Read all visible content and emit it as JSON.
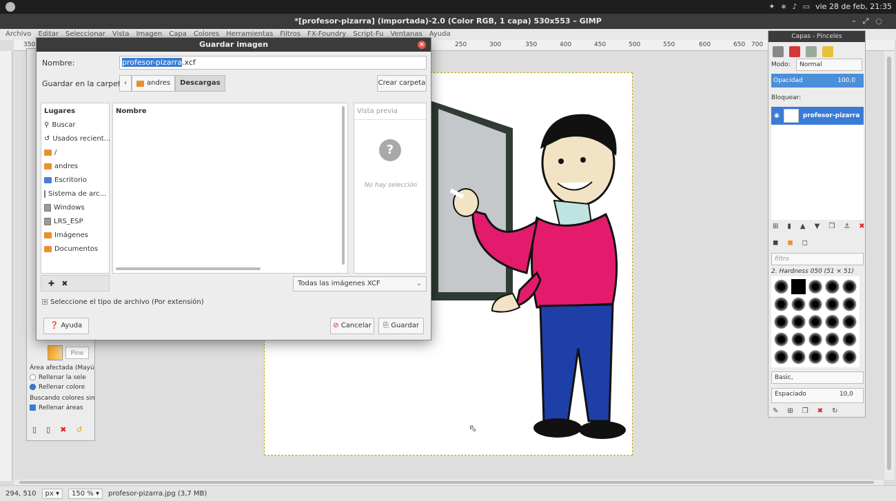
{
  "system": {
    "datetime": "vie 28 de feb, 21:35"
  },
  "gimp": {
    "window_title": "*[profesor-pizarra] (importada)-2.0 (Color RGB, 1 capa) 530x553 – GIMP",
    "menu": [
      "Archivo",
      "Editar",
      "Seleccionar",
      "Vista",
      "Imagen",
      "Capa",
      "Colores",
      "Herramientas",
      "Filtros",
      "FX-Foundry",
      "Script-Fu",
      "Ventanas",
      "Ayuda"
    ],
    "ruler_ticks": [
      "350",
      "250",
      "300",
      "350",
      "400",
      "450",
      "500",
      "550",
      "600",
      "650",
      "700"
    ]
  },
  "dialog": {
    "title": "Guardar imagen",
    "name_label": "Nombre:",
    "filename_selected": "profesor-pizarra",
    "filename_ext": ".xcf",
    "folder_label": "Guardar en la carpeta:",
    "breadcrumbs": [
      "andres",
      "Descargas"
    ],
    "create_folder": "Crear carpeta",
    "places_header": "Lugares",
    "places": [
      {
        "label": "Buscar",
        "icon": "search-icon"
      },
      {
        "label": "Usados recient...",
        "icon": "recent-icon"
      },
      {
        "label": "/",
        "icon": "folder-icon"
      },
      {
        "label": "andres",
        "icon": "folder-icon"
      },
      {
        "label": "Escritorio",
        "icon": "desktop-folder-icon"
      },
      {
        "label": "Sistema de arc...",
        "icon": "drive-icon"
      },
      {
        "label": "Windows",
        "icon": "drive-icon"
      },
      {
        "label": "LRS_ESP",
        "icon": "drive-icon"
      },
      {
        "label": "Imágenes",
        "icon": "folder-icon"
      },
      {
        "label": "Documentos",
        "icon": "folder-icon"
      }
    ],
    "files_header": "Nombre",
    "preview_header": "Vista previa",
    "preview_empty": "No hay selección",
    "filter_value": "Todas las imágenes XCF",
    "file_type_toggle": "Seleccione el tipo de archivo (Por extensión)",
    "help": "Ayuda",
    "cancel": "Cancelar",
    "save": "Guardar"
  },
  "toolbox": {
    "pine_label": "Pine",
    "affected_area": "Área afectada  (Mayú",
    "radio1": "Rellenar la sele",
    "radio2": "Rellenar colore",
    "search_label": "Buscando colores sin",
    "check1": "Rellenar áreas"
  },
  "layers_panel": {
    "title": "Capas - Pinceles",
    "mode_label": "Modo:",
    "mode_value": "Normal",
    "opacity_label": "Opacidad",
    "opacity_value": "100,0",
    "lock_label": "Bloquear:",
    "layer_name": "profesor-pizarra",
    "filter_placeholder": "filtro",
    "brush_name": "2. Hardness 050 (51 × 51)",
    "brush_preset": "Basic,",
    "spacing_label": "Espaciado",
    "spacing_value": "10,0"
  },
  "status": {
    "coords": "294, 510",
    "unit": "px",
    "zoom": "150 %",
    "file_info": "profesor-pizarra.jpg (3,7 MB)"
  }
}
